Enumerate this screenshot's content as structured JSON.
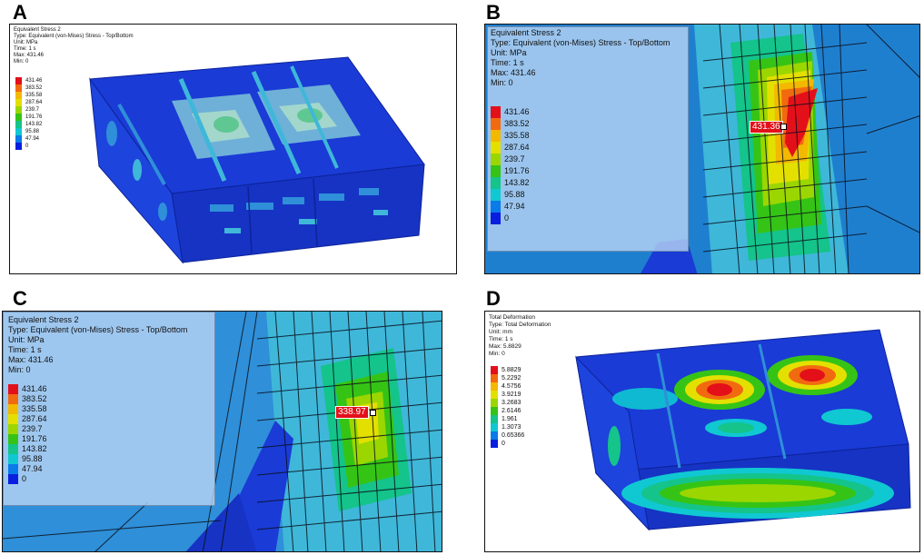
{
  "panels": {
    "A": {
      "letter": "A",
      "title": "Equivalent Stress 2",
      "type_line": "Type: Equivalent (von-Mises) Stress - Top/Bottom",
      "unit_line": "Unit: MPa",
      "time_line": "Time: 1 s",
      "max_line": "Max: 431.46",
      "min_line": "Min: 0",
      "legend": [
        "431.46",
        "383.52",
        "335.58",
        "287.64",
        "239.7",
        "191.76",
        "143.82",
        "95.88",
        "47.94",
        "0"
      ]
    },
    "B": {
      "letter": "B",
      "title": "Equivalent Stress 2",
      "type_line": "Type: Equivalent (von-Mises) Stress - Top/Bottom",
      "unit_line": "Unit: MPa",
      "time_line": "Time: 1 s",
      "max_line": "Max: 431.46",
      "min_line": "Min: 0",
      "legend": [
        "431.46",
        "383.52",
        "335.58",
        "287.64",
        "239.7",
        "191.76",
        "143.82",
        "95.88",
        "47.94",
        "0"
      ],
      "probe": "431.36"
    },
    "C": {
      "letter": "C",
      "title": "Equivalent Stress 2",
      "type_line": "Type: Equivalent (von-Mises) Stress - Top/Bottom",
      "unit_line": "Unit: MPa",
      "time_line": "Time: 1 s",
      "max_line": "Max: 431.46",
      "min_line": "Min: 0",
      "legend": [
        "431.46",
        "383.52",
        "335.58",
        "287.64",
        "239.7",
        "191.76",
        "143.82",
        "95.88",
        "47.94",
        "0"
      ],
      "probe": "338.97"
    },
    "D": {
      "letter": "D",
      "title": "Total Deformation",
      "type_line": "Type: Total Deformation",
      "unit_line": "Unit: mm",
      "time_line": "Time: 1 s",
      "max_line": "Max: 5.8829",
      "min_line": "Min: 0",
      "legend": [
        "5.8829",
        "5.2292",
        "4.5756",
        "3.9219",
        "3.2683",
        "2.6146",
        "1.961",
        "1.3073",
        "0.65366",
        "0"
      ]
    }
  },
  "legend_colors": [
    "#e3101a",
    "#f26a0f",
    "#f3b800",
    "#e3e000",
    "#9bd600",
    "#35c416",
    "#14c48a",
    "#10c8d2",
    "#0a7be8",
    "#0a1ee0"
  ],
  "surface_colors": {
    "base_blue": "#1a3bd6",
    "light_blue": "#2f8fd8",
    "cyan": "#3fb7d9",
    "overlay": "#bed7f5"
  }
}
